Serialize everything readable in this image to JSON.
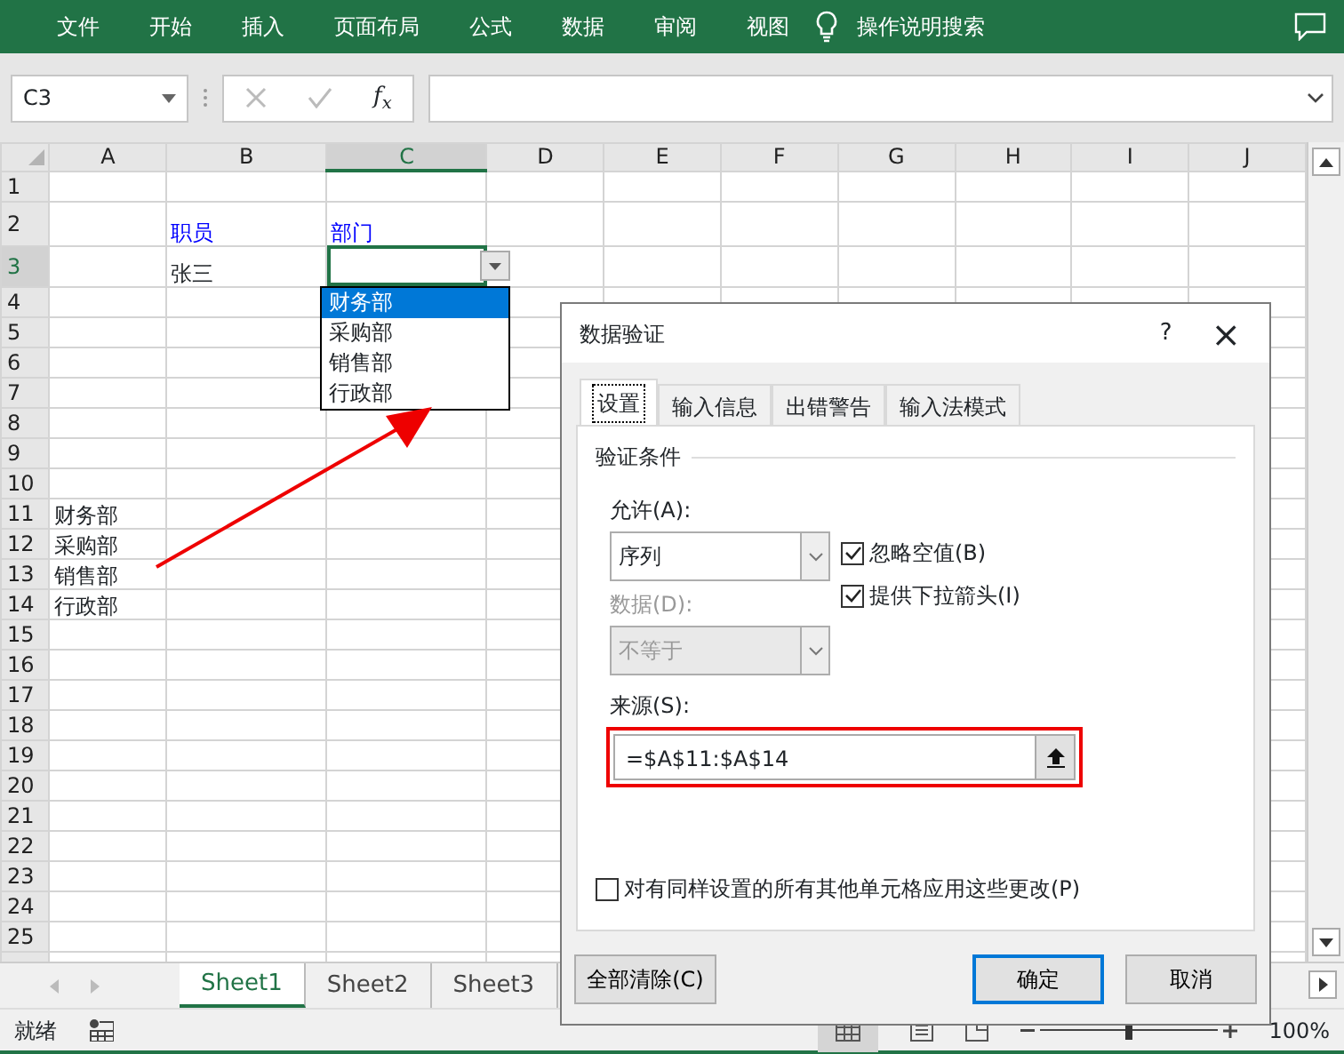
{
  "ribbon": {
    "tabs": [
      "文件",
      "开始",
      "插入",
      "页面布局",
      "公式",
      "数据",
      "审阅",
      "视图"
    ],
    "tell_me": "操作说明搜索"
  },
  "formula_bar": {
    "name_box": "C3",
    "function_label": "f$_{x}$"
  },
  "columns": [
    {
      "label": "A",
      "selected": false
    },
    {
      "label": "B",
      "selected": false
    },
    {
      "label": "C",
      "selected": true
    },
    {
      "label": "D",
      "selected": false
    },
    {
      "label": "E",
      "selected": false
    },
    {
      "label": "F",
      "selected": false
    },
    {
      "label": "G",
      "selected": false
    },
    {
      "label": "H",
      "selected": false
    },
    {
      "label": "I",
      "selected": false
    },
    {
      "label": "J",
      "selected": false
    }
  ],
  "rows": [
    {
      "label": "1",
      "selected": false,
      "cells": []
    },
    {
      "label": "2",
      "selected": false,
      "cells": [
        null,
        {
          "text": "职员",
          "kind": "heading"
        },
        {
          "text": "部门",
          "kind": "heading"
        }
      ]
    },
    {
      "label": "3",
      "selected": true,
      "cells": [
        null,
        {
          "text": "张三",
          "kind": "value"
        }
      ]
    },
    {
      "label": "4",
      "selected": false,
      "cells": []
    },
    {
      "label": "5",
      "selected": false,
      "cells": []
    },
    {
      "label": "6",
      "selected": false,
      "cells": []
    },
    {
      "label": "7",
      "selected": false,
      "cells": []
    },
    {
      "label": "8",
      "selected": false,
      "cells": []
    },
    {
      "label": "9",
      "selected": false,
      "cells": []
    },
    {
      "label": "10",
      "selected": false,
      "cells": []
    },
    {
      "label": "11",
      "selected": false,
      "cells": [
        {
          "text": "财务部",
          "kind": "plain"
        }
      ]
    },
    {
      "label": "12",
      "selected": false,
      "cells": [
        {
          "text": "采购部",
          "kind": "plain"
        }
      ]
    },
    {
      "label": "13",
      "selected": false,
      "cells": [
        {
          "text": "销售部",
          "kind": "plain"
        }
      ]
    },
    {
      "label": "14",
      "selected": false,
      "cells": [
        {
          "text": "行政部",
          "kind": "plain"
        }
      ]
    },
    {
      "label": "15",
      "selected": false,
      "cells": []
    },
    {
      "label": "16",
      "selected": false,
      "cells": []
    },
    {
      "label": "17",
      "selected": false,
      "cells": []
    },
    {
      "label": "18",
      "selected": false,
      "cells": []
    },
    {
      "label": "19",
      "selected": false,
      "cells": []
    },
    {
      "label": "20",
      "selected": false,
      "cells": []
    },
    {
      "label": "21",
      "selected": false,
      "cells": []
    },
    {
      "label": "22",
      "selected": false,
      "cells": []
    },
    {
      "label": "23",
      "selected": false,
      "cells": []
    },
    {
      "label": "24",
      "selected": false,
      "cells": []
    },
    {
      "label": "25",
      "selected": false,
      "cells": []
    }
  ],
  "cell_dropdown": [
    {
      "text": "财务部",
      "selected": true
    },
    {
      "text": "采购部",
      "selected": false
    },
    {
      "text": "销售部",
      "selected": false
    },
    {
      "text": "行政部",
      "selected": false
    }
  ],
  "dialog": {
    "title": "数据验证",
    "help": "?",
    "close": "×",
    "tabs": [
      {
        "label": "设置",
        "selected": true
      },
      {
        "label": "输入信息",
        "selected": false
      },
      {
        "label": "出错警告",
        "selected": false
      },
      {
        "label": "输入法模式",
        "selected": false
      }
    ],
    "section": "验证条件",
    "allow": {
      "label": "允许(A):",
      "value": "序列",
      "disabled": false
    },
    "data": {
      "label": "数据(D):",
      "value": "不等于",
      "disabled": true
    },
    "options": [
      {
        "label": "忽略空值(B)",
        "checked": true
      },
      {
        "label": "提供下拉箭头(I)",
        "checked": true
      }
    ],
    "source": {
      "label": "来源(S):",
      "value": "=$A$11:$A$14",
      "highlighted": true
    },
    "apply_all": {
      "label": "对有同样设置的所有其他单元格应用这些更改(P)",
      "checked": false
    },
    "buttons": [
      {
        "label": "全部清除(C)",
        "kind": "left",
        "default": false
      },
      {
        "label": "确定",
        "kind": "right",
        "default": true
      },
      {
        "label": "取消",
        "kind": "right",
        "default": false
      }
    ]
  },
  "sheet_tabs": [
    {
      "label": "Sheet1",
      "selected": true
    },
    {
      "label": "Sheet2",
      "selected": false
    },
    {
      "label": "Sheet3",
      "selected": false
    }
  ],
  "status_bar": {
    "status": "就绪",
    "zoom_slider": {
      "level": 0.5
    },
    "zoom": "100%"
  }
}
